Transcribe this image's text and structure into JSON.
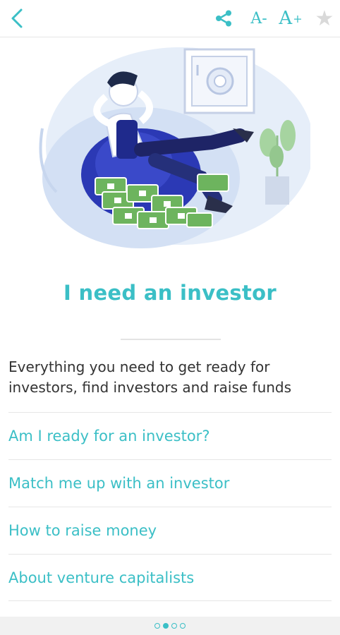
{
  "toolbar": {
    "back_icon": "chevron-left-icon",
    "share_icon": "share-icon",
    "decrease_font_label": "A-",
    "increase_font_label": "A",
    "increase_font_sup": "+",
    "favorite_icon": "star-icon",
    "accent_color": "#3bbfc6"
  },
  "hero": {
    "illustration": "investor-relaxing-illustration"
  },
  "page": {
    "title": "I need an investor",
    "description": "Everything you need to get ready for investors, find investors and raise funds"
  },
  "links": [
    {
      "label": "Am I ready for an investor?"
    },
    {
      "label": "Match me up with an investor"
    },
    {
      "label": "How to raise money"
    },
    {
      "label": "About venture capitalists"
    }
  ],
  "pager": {
    "total": 4,
    "active_index": 1
  }
}
